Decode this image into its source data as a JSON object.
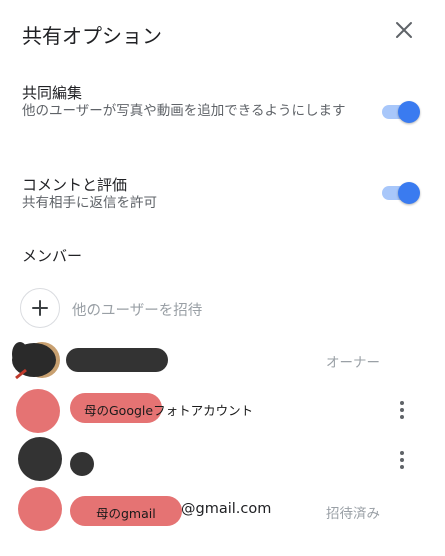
{
  "header": {
    "title": "共有オプション",
    "close_icon": "close-icon"
  },
  "options": [
    {
      "title": "共同編集",
      "description": "他のユーザーが写真や動画を追加できるようにします",
      "enabled": true
    },
    {
      "title": "コメントと評価",
      "description": "共有相手に返信を許可",
      "enabled": true
    }
  ],
  "members": {
    "section_title": "メンバー",
    "invite_label": "他のユーザーを招待",
    "list": [
      {
        "role": "オーナー"
      },
      {
        "name": "母のGoogleフォトアカウント"
      },
      {},
      {
        "name": "母のgmail",
        "email": "@gmail.com",
        "status": "招待済み"
      }
    ]
  },
  "colors": {
    "toggle_on": "#3a7bf0",
    "toggle_track": "#a8c7fa",
    "redaction": "#e57373"
  }
}
